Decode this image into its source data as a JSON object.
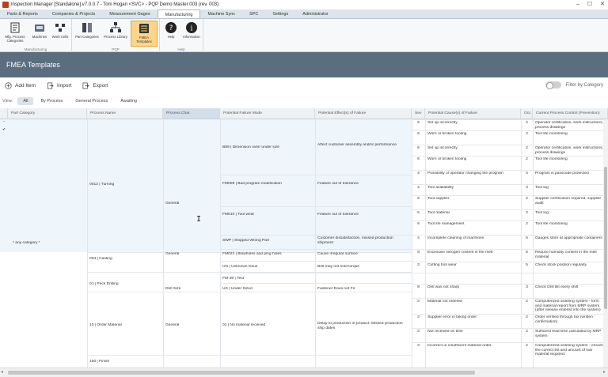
{
  "window": {
    "title": "Inspection Manager [Standalone] v7.0.0.7 - Tom Hogan <SVC> - PQP Demo Master 003 (rev. 003)"
  },
  "menu_tabs": [
    "Parts & Reports",
    "Companies & Projects",
    "Measurement Gages",
    "Manufacturing",
    "Machine Sync",
    "SPC",
    "Settings",
    "Administrator"
  ],
  "active_tab": "Manufacturing",
  "ribbon": {
    "groups": [
      {
        "label": "Manufacturing",
        "buttons": [
          {
            "label": "Mfg. Process Categories",
            "icon": "process-categories-icon"
          },
          {
            "label": "Machines",
            "icon": "machines-icon"
          },
          {
            "label": "Work Cells",
            "icon": "work-cells-icon"
          }
        ]
      },
      {
        "label": "PQP",
        "buttons": [
          {
            "label": "Part Categories",
            "icon": "part-categories-icon"
          },
          {
            "label": "Process Library",
            "icon": "process-library-icon"
          },
          {
            "label": "FMEA Templates",
            "icon": "fmea-templates-icon"
          }
        ]
      },
      {
        "label": "Help",
        "buttons": [
          {
            "label": "Help",
            "icon": "help-icon"
          },
          {
            "label": "Information",
            "icon": "information-icon"
          }
        ]
      }
    ],
    "selected": "FMEA Templates"
  },
  "page": {
    "title": "FMEA Templates"
  },
  "toolbar": {
    "add": "Add Item",
    "import": "Import",
    "export": "Export",
    "filter_label": "Filter by Category"
  },
  "view": {
    "label": "View:",
    "filters": [
      "All",
      "By Process",
      "General Process",
      "Awaiting"
    ],
    "active": "All"
  },
  "columns": [
    "Part Category",
    "Process Name",
    "Process Char.",
    "Potential Failure Mode",
    "Potential Effect(s) of Failure",
    "Sev",
    "Potential Cause(s) of Failure",
    "Occ",
    "Current Process Control (Prevention)"
  ],
  "part_category": "* any category *",
  "processes": [
    "0012 | Turning",
    "004 | Casting",
    "01 | Peck Drilling",
    "10 | Order Material",
    "150 | Finish"
  ],
  "process_chars": [
    "General",
    "General",
    "Drill Size",
    "General"
  ],
  "failure_modes": [
    "B99 | Dimension over/ under size",
    "FM009 | Bad program modification",
    "FM010 | Tool wear",
    "SWP | Shipped Wrong Part",
    "FM022 | Blowholes and ping holes",
    "UN | Unknown Issue",
    "FM-39 | Test",
    "US | Under Sized",
    "01 | No material received"
  ],
  "effects": [
    "Affect customer assembly and/or performance",
    "Feature out of tolerance",
    "Feature out of tolerance",
    "Customer dissatisfaction, missed production shipment",
    "Cause irregular surface",
    "Bolt may not hold torque",
    "Fastener Does not Fit",
    "Delay to production of product. Missed production ship dates"
  ],
  "rows": [
    {
      "sev": "6",
      "cause": "Set up incorrectly",
      "occ": "2",
      "control": "Operator certification, work instructions, process drawings"
    },
    {
      "sev": "6",
      "cause": "Worn or broken tooling",
      "occ": "2",
      "control": "Tool life monitoring"
    },
    {
      "sev": "6",
      "cause": "Set up incorrectly",
      "occ": "2",
      "control": "Operator certification, work instructions, process drawings"
    },
    {
      "sev": "6",
      "cause": "Worn or broken tooling",
      "occ": "2",
      "control": "Tool life monitoring"
    },
    {
      "sev": "4",
      "cause": "Possibility of operator changing the program",
      "occ": "4",
      "control": "Program is passcode protected"
    },
    {
      "sev": "4",
      "cause": "Tool availability",
      "occ": "3",
      "control": "Tool log"
    },
    {
      "sev": "6",
      "cause": "Tool supplier",
      "occ": "2",
      "control": "Supplier certification required, supplier audit"
    },
    {
      "sev": "6",
      "cause": "Tool material",
      "occ": "2",
      "control": "Tool log"
    },
    {
      "sev": "6",
      "cause": "Tool life management",
      "occ": "2",
      "control": "Tool life monitoring"
    },
    {
      "sev": "4",
      "cause": "Incomplete cleaning of machines",
      "occ": "5",
      "control": "Gauges store at appropriate containers"
    },
    {
      "sev": "8",
      "cause": "Excessive nitrogen content in the melt",
      "occ": "6",
      "control": "Reduce humidity content in the melt material"
    },
    {
      "sev": "3",
      "cause": "Cutting tool wear",
      "occ": "5",
      "control": "Check stock position regularly"
    },
    {
      "sev": "",
      "cause": "",
      "occ": "",
      "control": ""
    },
    {
      "sev": "8",
      "cause": "Drill was not sharp",
      "occ": "3",
      "control": "Check Drill Bit every shift"
    },
    {
      "sev": "3",
      "cause": "Material not ordered",
      "occ": "2",
      "control": "Computerized ordering system - form and material report from MRP system (after release entered into the system)"
    },
    {
      "sev": "3",
      "cause": "Supplier error in taking order",
      "occ": "2",
      "control": "Order verified through fax (written confirmation)"
    },
    {
      "sev": "3",
      "cause": "Not received on time",
      "occ": "2",
      "control": "Sufficient lead time calculated by MRP system"
    },
    {
      "sev": "3",
      "cause": "Incorrect or insufficient material order",
      "occ": "2",
      "control": "Computerized ordering system - ensures the correct list and amount of raw material required."
    }
  ],
  "row_markers": [
    "⌃",
    "✔"
  ],
  "colors": {
    "header_bg": "#5b6e80",
    "selected_tab": "#fbd58a",
    "band": "#eef5fb"
  }
}
